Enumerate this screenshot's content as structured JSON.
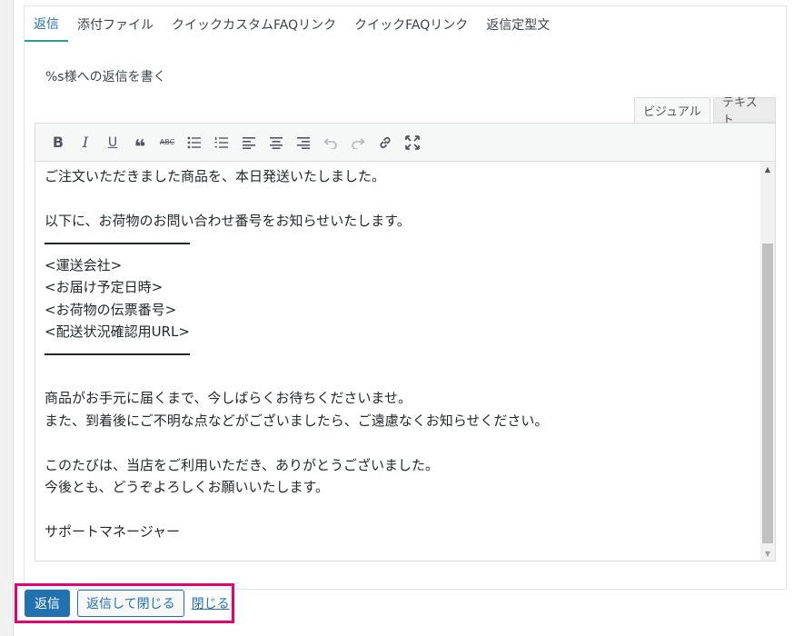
{
  "tabs": [
    {
      "label": "返信"
    },
    {
      "label": "添付ファイル"
    },
    {
      "label": "クイックカスタムFAQリンク"
    },
    {
      "label": "クイックFAQリンク"
    },
    {
      "label": "返信定型文"
    }
  ],
  "reply_label": "%s様への返信を書く",
  "editor": {
    "mode_visual": "ビジュアル",
    "mode_text": "テキスト",
    "lines": {
      "l1": "ご注文いただきました商品を、本日発送いたしました。",
      "l2": "以下に、お荷物のお問い合わせ番号をお知らせいたします。",
      "l3": "<運送会社>",
      "l4": "<お届け予定日時>",
      "l5": "<お荷物の伝票番号>",
      "l6": "<配送状況確認用URL>",
      "l7": "商品がお手元に届くまで、今しばらくお待ちくださいませ。",
      "l8": "また、到着後にご不明な点などがございましたら、ご遠慮なくお知らせください。",
      "l9": "このたびは、当店をご利用いただき、ありがとうございました。",
      "l10": "今後とも、どうぞよろしくお願いいたします。",
      "l11": "サポートマネージャー"
    }
  },
  "actions": {
    "reply": "返信",
    "reply_close": "返信して閉じる",
    "close": "閉じる"
  },
  "colors": {
    "accent": "#2271b1",
    "highlight_border": "#e4006f",
    "active_tab_underline": "#2f9e8f"
  }
}
